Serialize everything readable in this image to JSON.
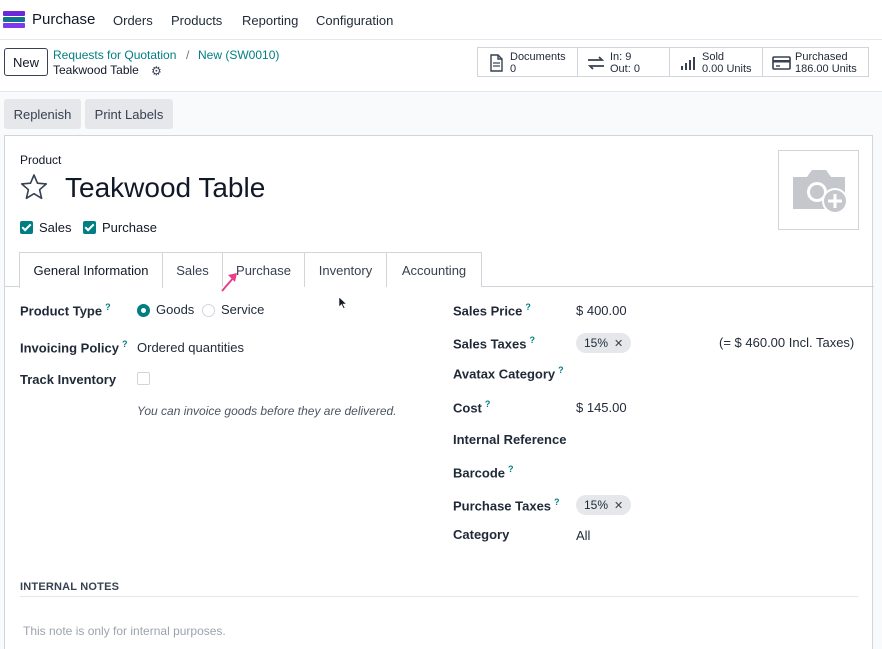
{
  "nav": {
    "app_name": "Purchase",
    "menu": [
      "Orders",
      "Products",
      "Reporting",
      "Configuration"
    ]
  },
  "control": {
    "new_label": "New",
    "breadcrumb": [
      "Requests for Quotation",
      "New (SW0010)"
    ],
    "breadcrumb_sep": "/",
    "record_title": "Teakwood Table",
    "smart_buttons": [
      {
        "icon": "document-icon",
        "line1": "Documents",
        "line2": "0"
      },
      {
        "icon": "transfer-icon",
        "line1": "In: 9",
        "line2": "Out: 0"
      },
      {
        "icon": "bar-chart-icon",
        "line1": "Sold",
        "line2": "0.00 Units"
      },
      {
        "icon": "credit-card-icon",
        "line1": "Purchased",
        "line2": "186.00 Units"
      }
    ]
  },
  "actions": {
    "replenish": "Replenish",
    "print_labels": "Print Labels"
  },
  "form": {
    "product_label": "Product",
    "product_name": "Teakwood Table",
    "can_be_sold": "Sales",
    "can_be_purchased": "Purchase",
    "tabs": [
      "General Information",
      "Sales",
      "Purchase",
      "Inventory",
      "Accounting"
    ],
    "active_tab": "General Information",
    "left": {
      "product_type_label": "Product Type",
      "type_goods": "Goods",
      "type_service": "Service",
      "invoicing_policy_label": "Invoicing Policy",
      "invoicing_policy_value": "Ordered quantities",
      "track_inventory_label": "Track Inventory",
      "hint": "You can invoice goods before they are delivered."
    },
    "right": {
      "sales_price_label": "Sales Price",
      "sales_price_value": "$ 400.00",
      "sales_taxes_label": "Sales Taxes",
      "sales_tax_tag": "15%",
      "incl_taxes": "(= $ 460.00 Incl. Taxes)",
      "avatax_label": "Avatax Category",
      "cost_label": "Cost",
      "cost_value": "$ 145.00",
      "internal_ref_label": "Internal Reference",
      "barcode_label": "Barcode",
      "purchase_taxes_label": "Purchase Taxes",
      "purchase_tax_tag": "15%",
      "category_label": "Category",
      "category_value": "All"
    },
    "help_mark": "?",
    "tag_remove": "✕",
    "internal_notes_title": "INTERNAL NOTES",
    "internal_notes_placeholder": "This note is only for internal purposes."
  },
  "colors": {
    "accent": "#017e84",
    "arrow": "#e83e8c"
  }
}
